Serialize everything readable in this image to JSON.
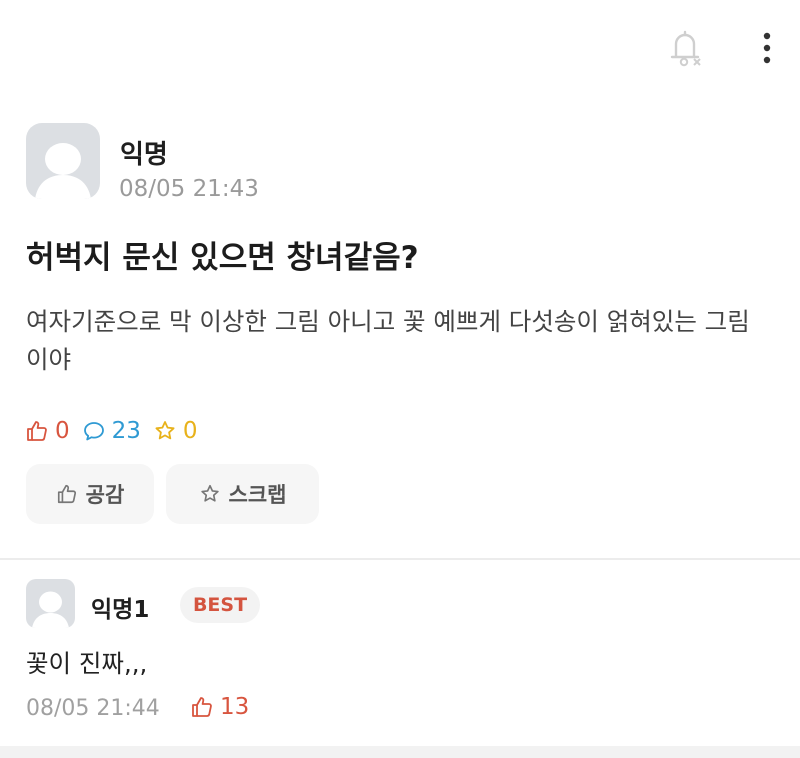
{
  "header": {
    "notification_icon": "bell-off-icon",
    "menu_icon": "more-vertical-icon"
  },
  "post": {
    "author": "익명",
    "timestamp": "08/05 21:43",
    "title": "허벅지 문신 있으면 창녀같음?",
    "body": "여자기준으로 막 이상한 그림 아니고 꽃 예쁘게 다섯송이 얽혀있는 그림이야",
    "stats": {
      "likes": "0",
      "comments": "23",
      "scraps": "0"
    },
    "actions": {
      "empathy_label": "공감",
      "scrap_label": "스크랩"
    }
  },
  "comment": {
    "author": "익명1",
    "badge": "BEST",
    "text": "꽃이 진짜,,,",
    "timestamp": "08/05 21:44",
    "likes": "13"
  },
  "colors": {
    "like": "#d8553f",
    "comment": "#2f9ad3",
    "scrap": "#e8b21b",
    "muted": "#9a9a9a"
  }
}
